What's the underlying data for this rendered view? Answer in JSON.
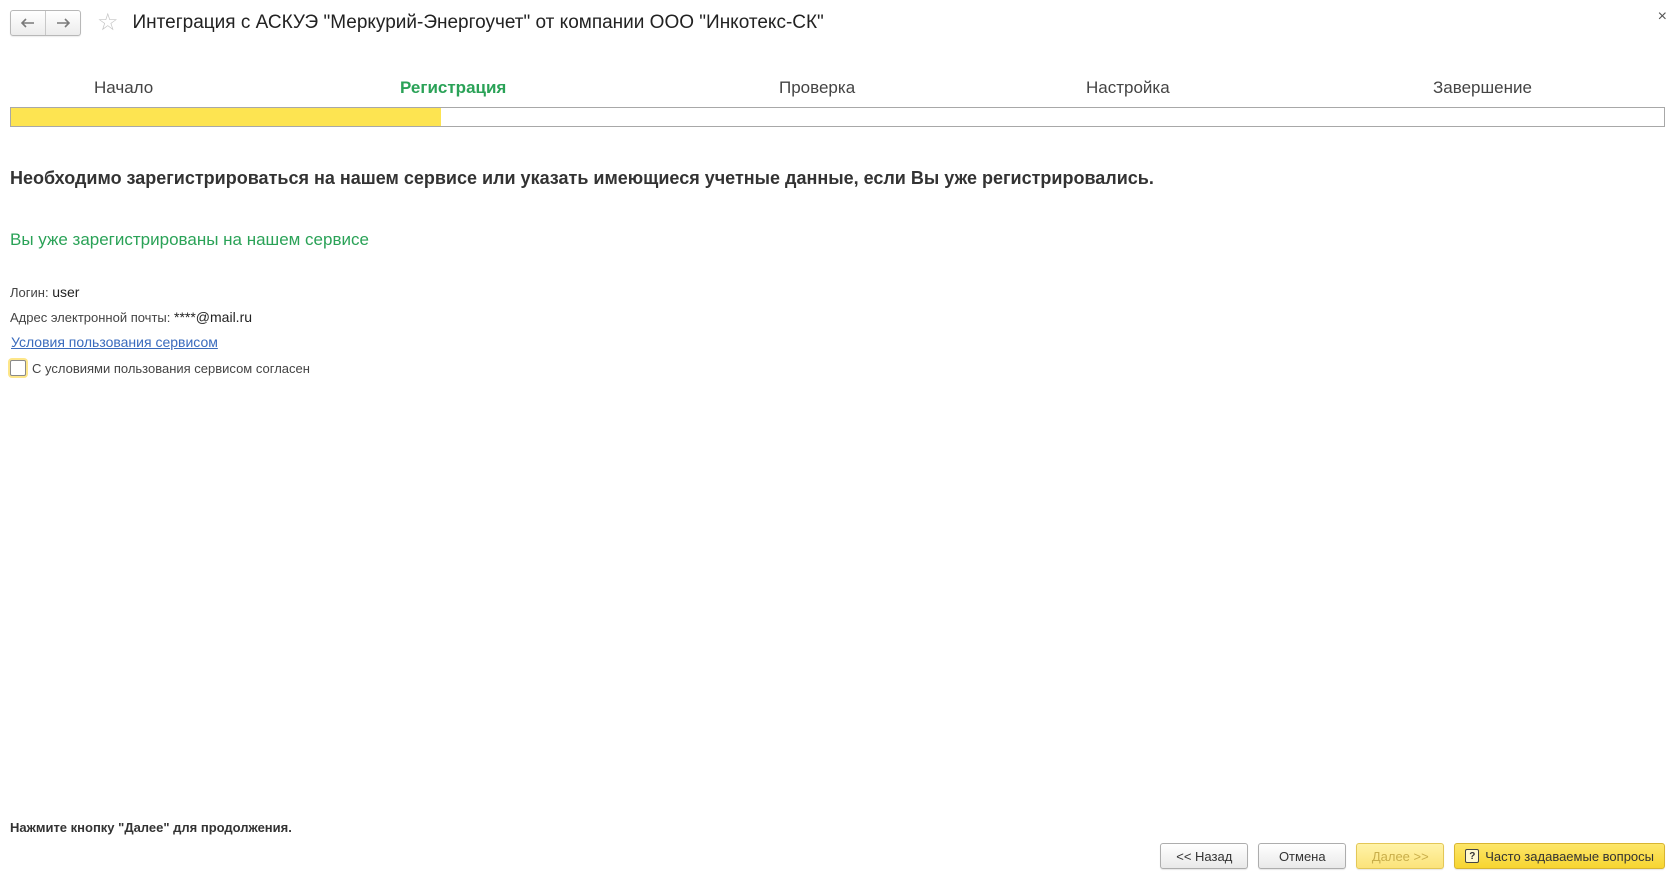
{
  "window": {
    "title": "Интеграция с АСКУЭ \"Меркурий-Энергоучет\" от компании ООО \"Инкотекс-СК\"",
    "close": "×"
  },
  "nav": {
    "back_icon": "arrow-left-icon",
    "forward_icon": "arrow-right-icon",
    "favorite_icon": "star-icon"
  },
  "steps": [
    {
      "label": "Начало",
      "active": false
    },
    {
      "label": "Регистрация",
      "active": true
    },
    {
      "label": "Проверка",
      "active": false
    },
    {
      "label": "Настройка",
      "active": false
    },
    {
      "label": "Завершение",
      "active": false
    }
  ],
  "progress": {
    "fraction": 0.26,
    "color": "#fde451"
  },
  "content": {
    "headline": "Необходимо зарегистрироваться на нашем сервисе или указать имеющиеся учетные данные, если Вы уже регистрировались.",
    "status": "Вы уже зарегистрированы на нашем сервисе",
    "login_label": "Логин:",
    "login_value": "user",
    "email_label": "Адрес электронной почты:",
    "email_value": "****@mail.ru",
    "terms_link": "Условия пользования сервисом",
    "agree_label": "С условиями пользования сервисом согласен",
    "agree_checked": false
  },
  "footer": {
    "hint": "Нажмите кнопку \"Далее\" для продолжения.",
    "back_button": "<< Назад",
    "cancel_button": "Отмена",
    "next_button": "Далее >>",
    "faq_button": "Часто задаваемые вопросы"
  },
  "colors": {
    "accent_green": "#2aa257",
    "link_blue": "#3a6bbd",
    "highlight_yellow": "#fde451"
  }
}
